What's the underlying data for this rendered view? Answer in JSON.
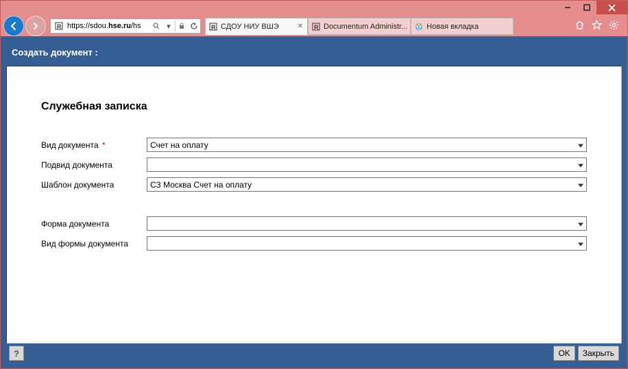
{
  "window": {
    "url_prefix": "https://sdou.",
    "url_bold": "hse.ru",
    "url_suffix": "/hs"
  },
  "tabs": [
    {
      "label": "СДОУ НИУ ВШЭ",
      "icon": "favicon-r"
    },
    {
      "label": "Documentum Administr...",
      "icon": "favicon-r"
    },
    {
      "label": "Новая вкладка",
      "icon": "ie-icon"
    }
  ],
  "page": {
    "title": "Создать документ :",
    "form_heading": "Служебная записка",
    "labels": {
      "doc_type": "Вид документа",
      "doc_subtype": "Подвид документа",
      "doc_template": "Шаблон документа",
      "doc_form": "Форма документа",
      "doc_form_type": "Вид формы документа"
    },
    "values": {
      "doc_type": "Счет на оплату",
      "doc_subtype": "",
      "doc_template": "СЗ Москва Счет на оплату",
      "doc_form": "",
      "doc_form_type": ""
    },
    "buttons": {
      "ok": "OK",
      "close": "Закрыть",
      "help": "?"
    }
  }
}
